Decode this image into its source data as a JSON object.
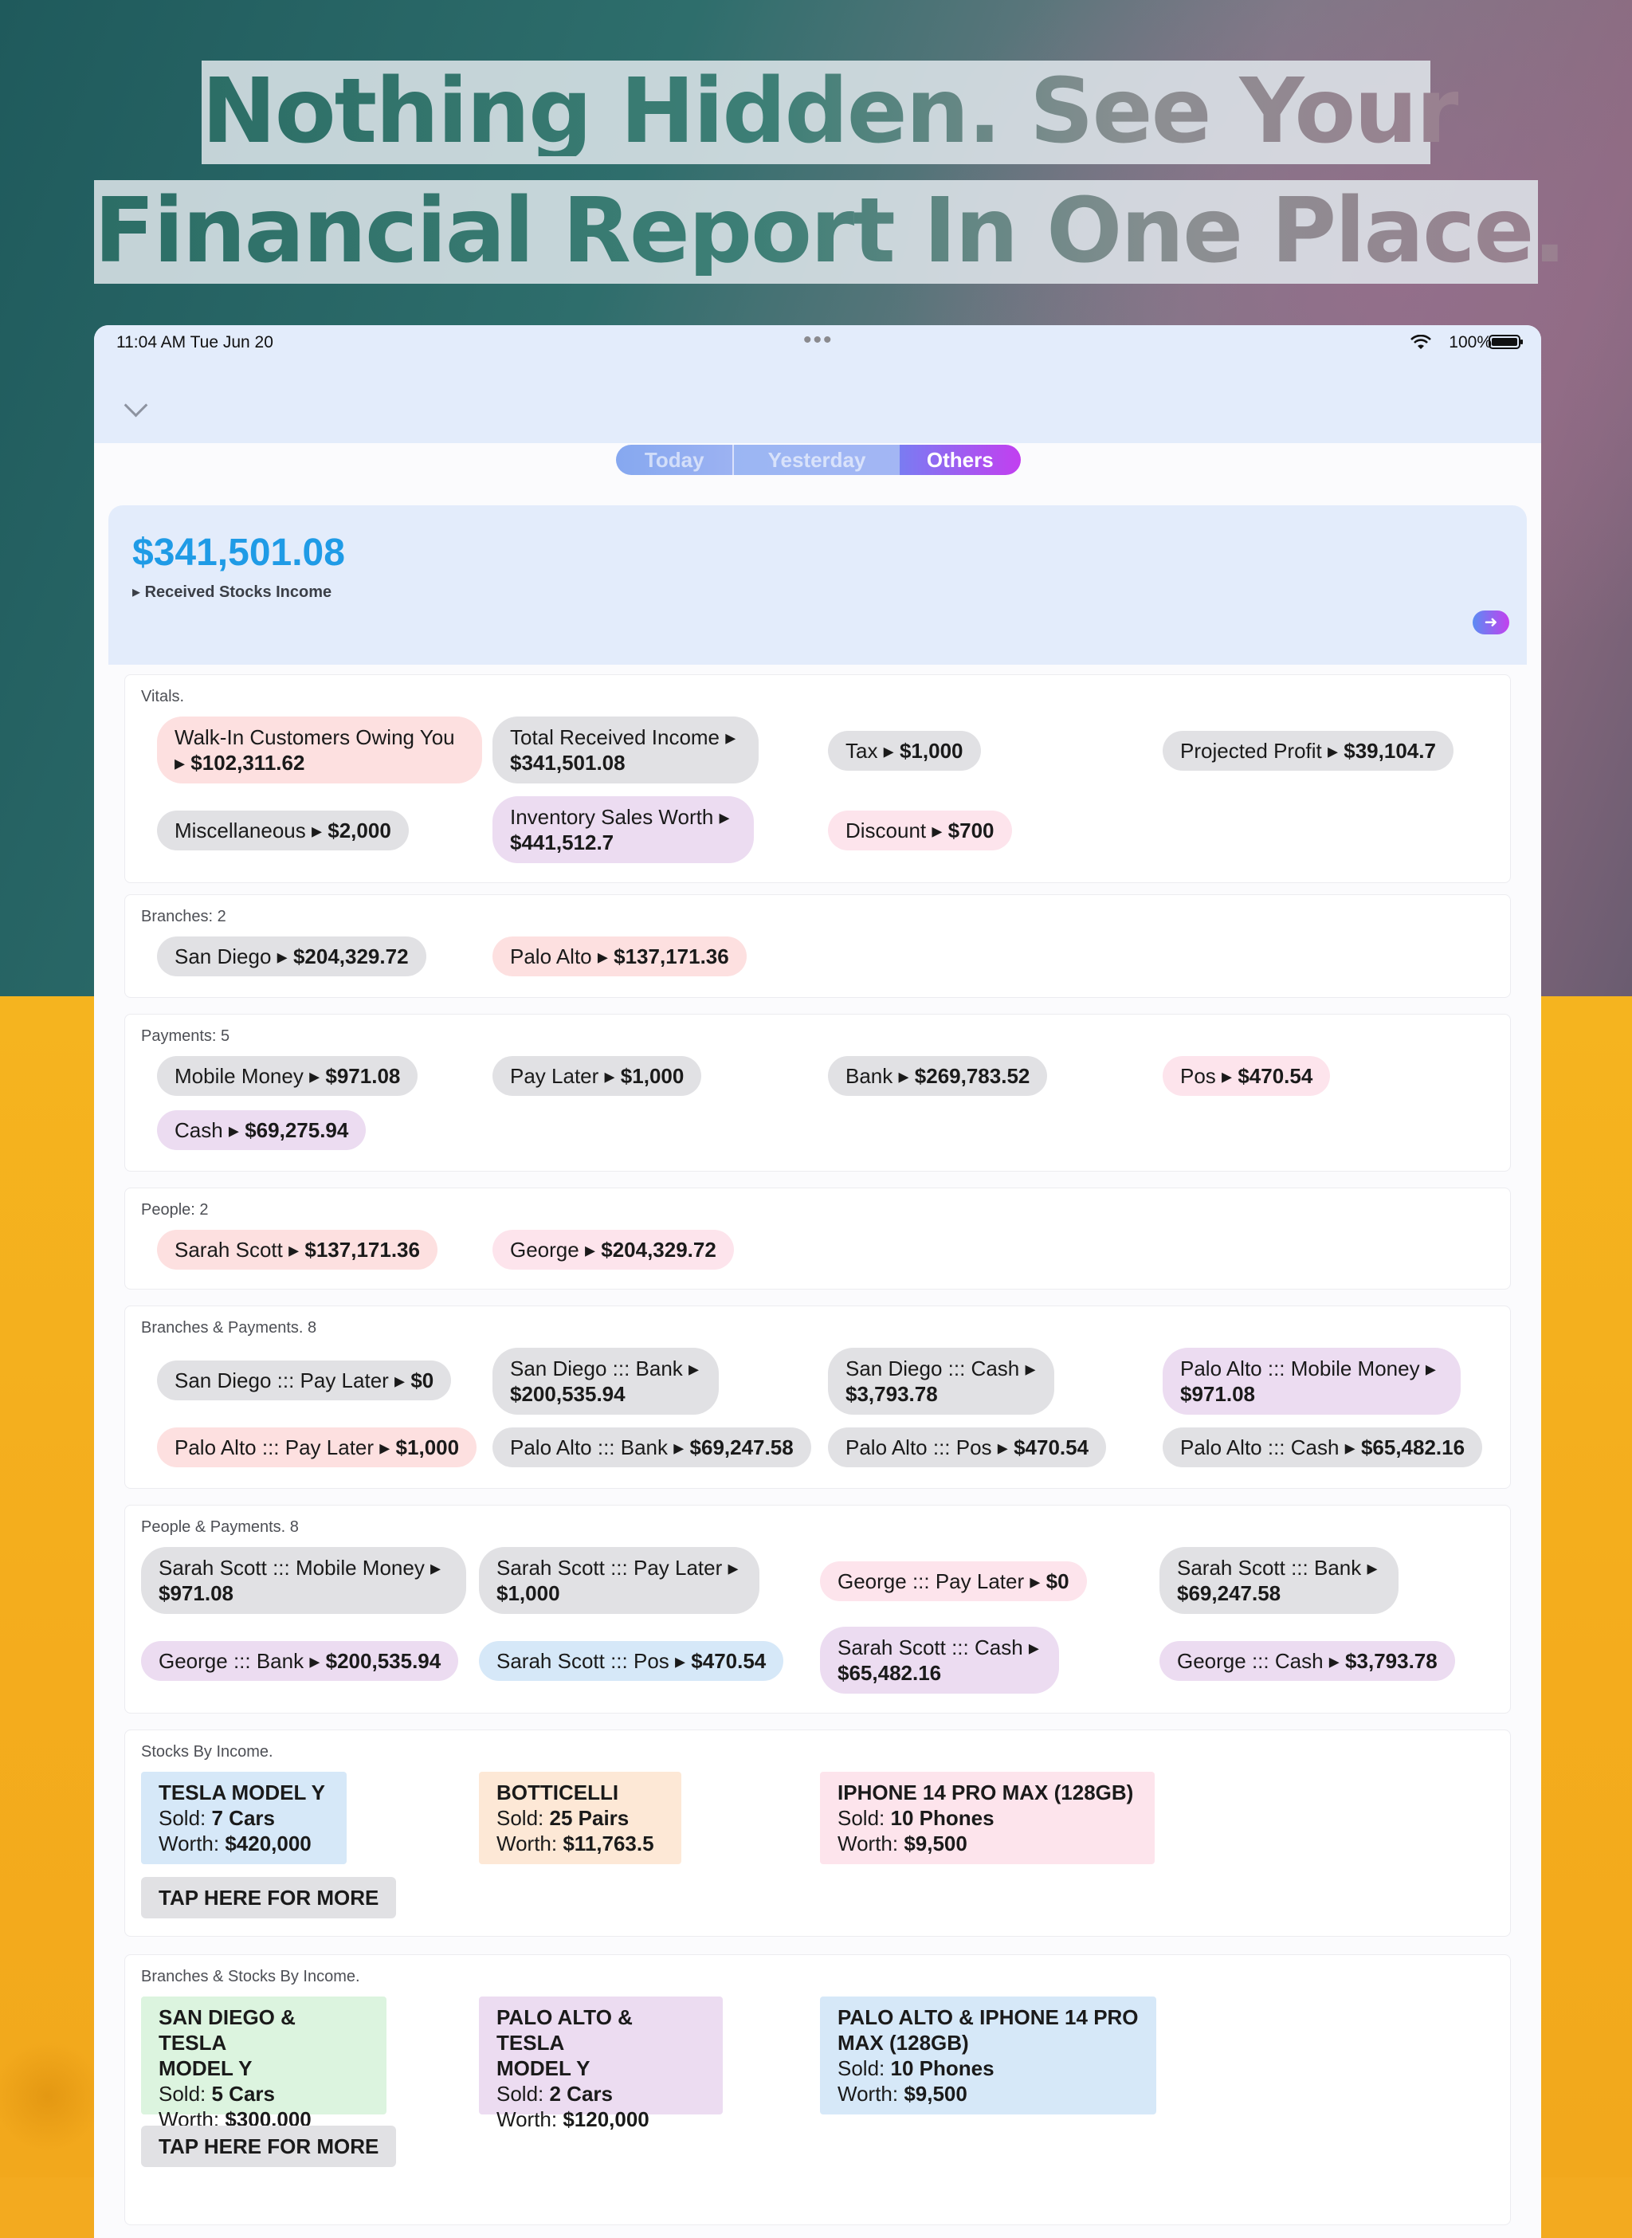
{
  "headline": {
    "line1": "Nothing Hidden. See Your",
    "line2": "Financial Report In One Place."
  },
  "status_bar": {
    "time_date": "11:04 AM   Tue Jun 20",
    "dots": "•••",
    "battery": "100%"
  },
  "tabs": [
    "Today",
    "Yesterday",
    "Others"
  ],
  "active_tab": "Others",
  "summary": {
    "amount": "$341,501.08",
    "label": "▸ Received Stocks Income",
    "go_icon": "➜"
  },
  "vitals": {
    "title": "Vitals.",
    "items": [
      {
        "label": "Walk-In Customers Owing You",
        "value": "▸ $102,311.62"
      },
      {
        "label": "Total Received Income ▸",
        "value": "$341,501.08"
      },
      {
        "label": "Tax ▸ ",
        "value": "$1,000"
      },
      {
        "label": "Projected Profit ▸ ",
        "value": "$39,104.7"
      },
      {
        "label": "Miscellaneous ▸ ",
        "value": "$2,000"
      },
      {
        "label": "Inventory Sales Worth ▸",
        "value": "$441,512.7"
      },
      {
        "label": "Discount ▸ ",
        "value": "$700"
      }
    ]
  },
  "branches": {
    "title": "Branches: 2",
    "items": [
      {
        "label": "San Diego ▸ ",
        "value": "$204,329.72"
      },
      {
        "label": "Palo Alto ▸ ",
        "value": "$137,171.36"
      }
    ]
  },
  "payments": {
    "title": "Payments: 5",
    "items": [
      {
        "label": "Mobile Money ▸ ",
        "value": "$971.08"
      },
      {
        "label": "Pay Later ▸ ",
        "value": "$1,000"
      },
      {
        "label": "Bank ▸ ",
        "value": "$269,783.52"
      },
      {
        "label": "Pos ▸ ",
        "value": "$470.54"
      },
      {
        "label": "Cash ▸ ",
        "value": "$69,275.94"
      }
    ]
  },
  "people": {
    "title": "People: 2",
    "items": [
      {
        "label": "Sarah Scott ▸ ",
        "value": "$137,171.36"
      },
      {
        "label": "George ▸ ",
        "value": "$204,329.72"
      }
    ]
  },
  "branches_payments": {
    "title": "Branches & Payments. 8",
    "items": [
      {
        "label": "San Diego ::: Pay Later ▸ ",
        "value": "$0"
      },
      {
        "label": "San Diego ::: Bank ▸",
        "value": "$200,535.94"
      },
      {
        "label": "San Diego ::: Cash ▸",
        "value": "$3,793.78"
      },
      {
        "label": "Palo Alto ::: Mobile Money ▸",
        "value": "$971.08"
      },
      {
        "label": "Palo Alto ::: Pay Later ▸ ",
        "value": "$1,000"
      },
      {
        "label": "Palo Alto ::: Bank ▸ ",
        "value": "$69,247.58"
      },
      {
        "label": "Palo Alto ::: Pos ▸ ",
        "value": "$470.54"
      },
      {
        "label": "Palo Alto ::: Cash ▸ ",
        "value": "$65,482.16"
      }
    ]
  },
  "people_payments": {
    "title": "People & Payments. 8",
    "items": [
      {
        "label": "Sarah Scott ::: Mobile Money ▸",
        "value": "$971.08"
      },
      {
        "label": "Sarah Scott ::: Pay Later ▸",
        "value": "$1,000"
      },
      {
        "label": "George ::: Pay Later ▸ ",
        "value": "$0"
      },
      {
        "label": "Sarah Scott ::: Bank ▸",
        "value": "$69,247.58"
      },
      {
        "label": "George ::: Bank ▸ ",
        "value": "$200,535.94"
      },
      {
        "label": "Sarah Scott ::: Pos ▸ ",
        "value": "$470.54"
      },
      {
        "label": "Sarah Scott ::: Cash ▸",
        "value": "$65,482.16"
      },
      {
        "label": "George ::: Cash ▸ ",
        "value": "$3,793.78"
      }
    ]
  },
  "stocks_by_income": {
    "title": "Stocks By Income.",
    "cards": [
      {
        "name": "TESLA MODEL Y",
        "sold_label": "Sold: ",
        "sold": "7 Cars",
        "worth_label": "Worth: ",
        "worth": "$420,000"
      },
      {
        "name": "BOTTICELLI",
        "sold_label": "Sold: ",
        "sold": "25 Pairs",
        "worth_label": "Worth: ",
        "worth": "$11,763.5"
      },
      {
        "name": "IPHONE 14 PRO MAX (128GB)",
        "sold_label": "Sold: ",
        "sold": "10 Phones",
        "worth_label": "Worth: ",
        "worth": "$9,500"
      }
    ],
    "more": "TAP HERE FOR MORE"
  },
  "branches_stocks": {
    "title": "Branches & Stocks By Income.",
    "cards": [
      {
        "name1": "SAN DIEGO & TESLA",
        "name2": "MODEL Y",
        "sold_label": "Sold: ",
        "sold": "5 Cars",
        "worth_label": "Worth: ",
        "worth": "$300,000"
      },
      {
        "name1": "PALO ALTO & TESLA",
        "name2": "MODEL Y",
        "sold_label": "Sold: ",
        "sold": "2 Cars",
        "worth_label": "Worth: ",
        "worth": "$120,000"
      },
      {
        "name1": "PALO ALTO & IPHONE 14 PRO",
        "name2": "MAX (128GB)",
        "sold_label": "Sold: ",
        "sold": "10 Phones",
        "worth_label": "Worth: ",
        "worth": "$9,500"
      }
    ],
    "more": "TAP HERE FOR MORE"
  },
  "colors": {
    "accent_blue": "#1f9be6",
    "tab_active_gradient": [
      "#7a7cf2",
      "#c23ff0"
    ],
    "background_bottom": "#f4ad1d",
    "background_top": "#2e6e6c"
  }
}
